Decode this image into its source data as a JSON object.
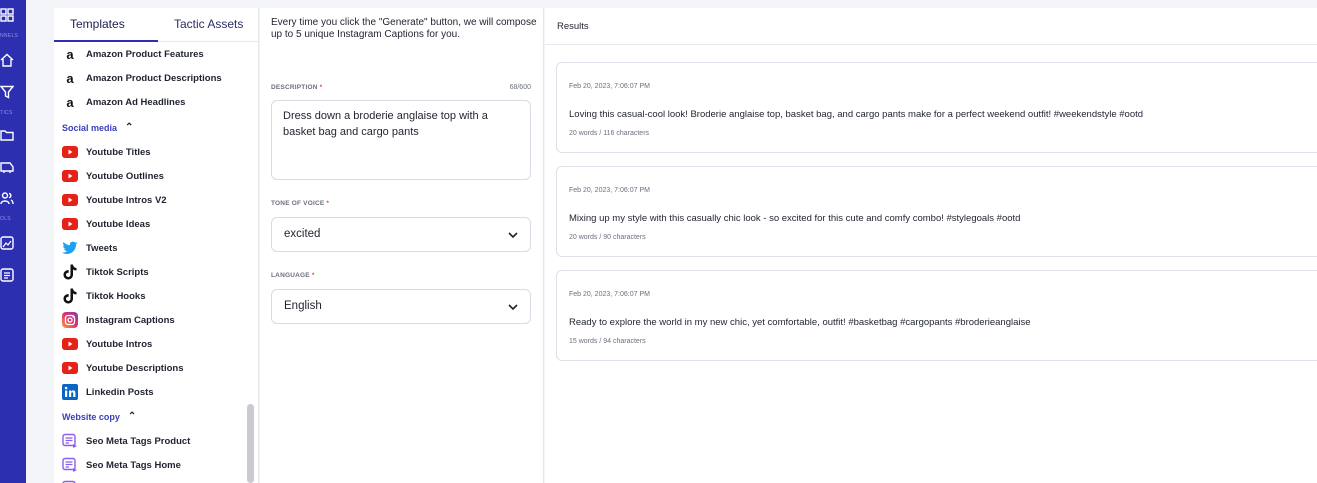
{
  "rail": {
    "labels": [
      "NNELS",
      "TICS",
      "OLS"
    ],
    "icons": [
      "grid-icon",
      "home-icon",
      "filter-icon",
      "folder-icon",
      "bus-icon",
      "users-icon",
      "image-icon",
      "list-icon"
    ]
  },
  "left_panel": {
    "tabs": [
      {
        "label": "Templates",
        "active": true
      },
      {
        "label": "Tactic Assets",
        "active": false
      }
    ],
    "items_top": [
      {
        "label": "Amazon Product Features",
        "icon": "amazon-icon"
      },
      {
        "label": "Amazon Product Descriptions",
        "icon": "amazon-icon"
      },
      {
        "label": "Amazon Ad Headlines",
        "icon": "amazon-icon"
      }
    ],
    "social_section": "Social media",
    "social_items": [
      {
        "label": "Youtube Titles",
        "icon": "youtube-icon"
      },
      {
        "label": "Youtube Outlines",
        "icon": "youtube-icon"
      },
      {
        "label": "Youtube Intros V2",
        "icon": "youtube-icon"
      },
      {
        "label": "Youtube Ideas",
        "icon": "youtube-icon"
      },
      {
        "label": "Tweets",
        "icon": "twitter-icon"
      },
      {
        "label": "Tiktok Scripts",
        "icon": "tiktok-icon"
      },
      {
        "label": "Tiktok Hooks",
        "icon": "tiktok-icon"
      },
      {
        "label": "Instagram Captions",
        "icon": "instagram-icon"
      },
      {
        "label": "Youtube Intros",
        "icon": "youtube-icon"
      },
      {
        "label": "Youtube Descriptions",
        "icon": "youtube-icon"
      },
      {
        "label": "Linkedin Posts",
        "icon": "linkedin-icon"
      }
    ],
    "website_section": "Website copy",
    "website_items": [
      {
        "label": "Seo Meta Tags Product",
        "icon": "seo-icon"
      },
      {
        "label": "Seo Meta Tags Home",
        "icon": "seo-icon"
      }
    ]
  },
  "form": {
    "intro": "Every time you click the \"Generate\" button, we will compose up to 5 unique Instagram Captions for you.",
    "description_label": "DESCRIPTION",
    "description_counter": "68/600",
    "description_value": "Dress down a broderie anglaise top with a basket bag and cargo pants",
    "tone_label": "TONE OF VOICE",
    "tone_value": "excited",
    "language_label": "LANGUAGE",
    "language_value": "English",
    "required_mark": "*"
  },
  "results": {
    "title": "Results",
    "cards": [
      {
        "timestamp": "Feb 20, 2023, 7:06:07 PM",
        "text": "Loving this casual-cool look! Broderie anglaise top, basket bag, and cargo pants make for a perfect weekend outfit! #weekendstyle #ootd",
        "meta": "20 words / 116 characters"
      },
      {
        "timestamp": "Feb 20, 2023, 7:06:07 PM",
        "text": "Mixing up my style with this casually chic look - so excited for this cute and comfy combo! #stylegoals #ootd",
        "meta": "20 words / 90 characters"
      },
      {
        "timestamp": "Feb 20, 2023, 7:06:07 PM",
        "text": "Ready to explore the world in my new chic, yet comfortable, outfit! #basketbag #cargopants #broderieanglaise",
        "meta": "15 words / 94 characters"
      }
    ]
  },
  "colors": {
    "rail": "#2c2fb0",
    "accent": "#3a3fb8",
    "youtube": "#e62117",
    "twitter": "#1da1f2",
    "linkedin": "#0a66c2",
    "required": "#e0475b"
  }
}
